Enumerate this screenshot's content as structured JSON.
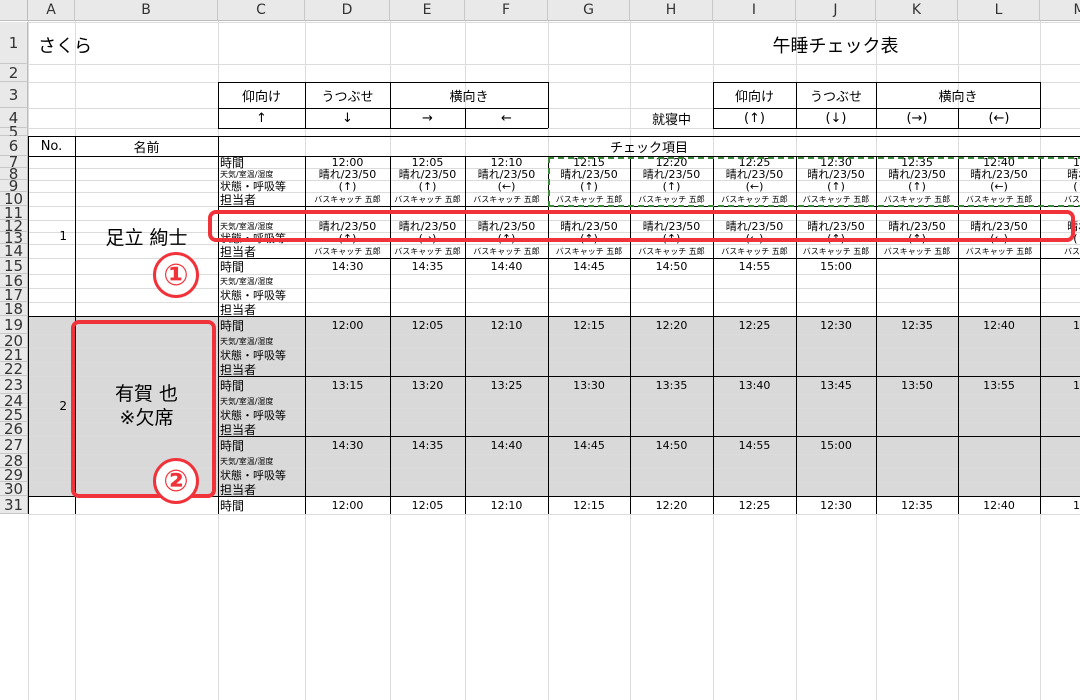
{
  "columns": [
    "A",
    "B",
    "C",
    "D",
    "E",
    "F",
    "G",
    "H",
    "I",
    "J",
    "K",
    "L",
    "M"
  ],
  "rows": [
    "1",
    "2",
    "3",
    "4",
    "5",
    "6",
    "7",
    "8",
    "9",
    "10",
    "11",
    "12",
    "13",
    "14",
    "15",
    "16",
    "17",
    "18",
    "19",
    "20",
    "21",
    "22",
    "23",
    "24",
    "25",
    "26",
    "27",
    "28",
    "29",
    "30",
    "31"
  ],
  "header": {
    "group_name": "さくら",
    "sheet_title": "午睡チェック表",
    "legend_left": {
      "labels": [
        "仰向け",
        "うつぶせ",
        "横向き"
      ],
      "arrows": [
        "↑",
        "↓",
        "→",
        "←"
      ]
    },
    "legend_right": {
      "sleeping_label": "就寝中",
      "labels": [
        "仰向け",
        "うつぶせ",
        "横向き"
      ],
      "arrows": [
        "(↑)",
        "(↓)",
        "(→)",
        "(←)"
      ]
    }
  },
  "table_header": {
    "no": "No.",
    "name": "名前",
    "check_items": "チェック項目"
  },
  "item_labels": {
    "time": "時間",
    "weather": "天気/室温/湿度",
    "status": "状態・呼吸等",
    "staff": "担当者"
  },
  "children": [
    {
      "no": "1",
      "name": "足立 絢士",
      "blocks": [
        {
          "times": [
            "12:00",
            "12:05",
            "12:10",
            "12:15",
            "12:20",
            "12:25",
            "12:30",
            "12:35",
            "12:40",
            "12"
          ],
          "weather": [
            "晴れ/23/50",
            "晴れ/23/50",
            "晴れ/23/50",
            "晴れ/23/50",
            "晴れ/23/50",
            "晴れ/23/50",
            "晴れ/23/50",
            "晴れ/23/50",
            "晴れ/23/50",
            "晴れ/"
          ],
          "status": [
            "(↑)",
            "(↑)",
            "(←)",
            "(↑)",
            "(↑)",
            "(←)",
            "(↑)",
            "(↑)",
            "(←)",
            "(↑"
          ],
          "staff": [
            "バスキャッチ 五郎",
            "バスキャッチ 五郎",
            "バスキャッチ 五郎",
            "バスキャッチ 五郎",
            "バスキャッチ 五郎",
            "バスキャッチ 五郎",
            "バスキャッチ 五郎",
            "バスキャッチ 五郎",
            "バスキャッチ 五郎",
            "バスキャ"
          ]
        },
        {
          "weather": [
            "晴れ/23/50",
            "晴れ/23/50",
            "晴れ/23/50",
            "晴れ/23/50",
            "晴れ/23/50",
            "晴れ/23/50",
            "晴れ/23/50",
            "晴れ/23/50",
            "晴れ/23/50",
            "晴れ/"
          ],
          "status": [
            "(↑)",
            "(→)",
            "(↑)",
            "(↑)",
            "(↑)",
            "(←)",
            "(↑)",
            "(↑)",
            "(←)",
            "(↑"
          ],
          "staff": [
            "バスキャッチ 五郎",
            "バスキャッチ 五郎",
            "バスキャッチ 五郎",
            "バスキャッチ 五郎",
            "バスキャッチ 五郎",
            "バスキャッチ 五郎",
            "バスキャッチ 五郎",
            "バスキャッチ 五郎",
            "バスキャッチ 五郎",
            "バスキャ"
          ]
        },
        {
          "times": [
            "14:30",
            "14:35",
            "14:40",
            "14:45",
            "14:50",
            "14:55",
            "15:00"
          ]
        }
      ]
    },
    {
      "no": "2",
      "name": "有賀 也",
      "note": "※欠席",
      "blocks": [
        {
          "times": [
            "12:00",
            "12:05",
            "12:10",
            "12:15",
            "12:20",
            "12:25",
            "12:30",
            "12:35",
            "12:40",
            "12"
          ]
        },
        {
          "times": [
            "13:15",
            "13:20",
            "13:25",
            "13:30",
            "13:35",
            "13:40",
            "13:45",
            "13:50",
            "13:55",
            "14"
          ]
        },
        {
          "times": [
            "14:30",
            "14:35",
            "14:40",
            "14:45",
            "14:50",
            "14:55",
            "15:00"
          ]
        }
      ]
    }
  ],
  "row31_times": [
    "12:00",
    "12:05",
    "12:10",
    "12:15",
    "12:20",
    "12:25",
    "12:30",
    "12:35",
    "12:40",
    "12"
  ],
  "annotations": [
    "①",
    "②"
  ],
  "colors": {
    "highlight_red": "#f0333a",
    "dashed_green": "#3a8a3a",
    "absent_gray": "#d9d9d9",
    "header_gray": "#e9e9e9"
  }
}
